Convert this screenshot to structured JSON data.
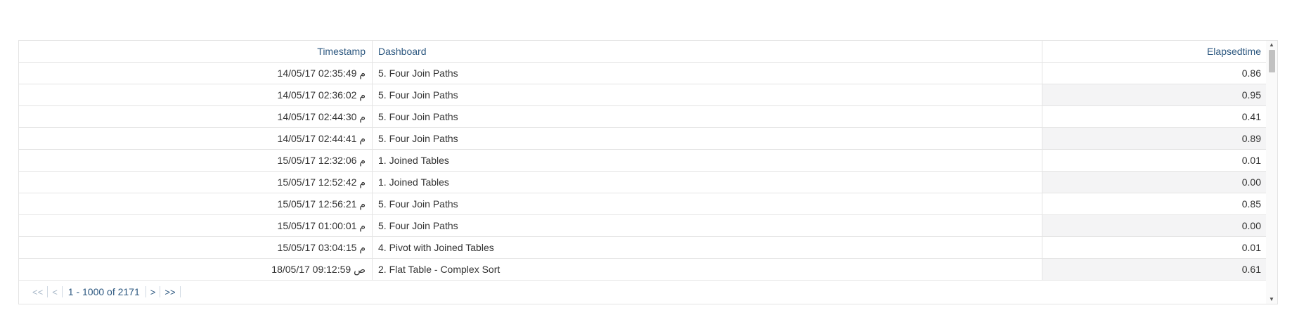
{
  "table": {
    "columns": {
      "timestamp": "Timestamp",
      "dashboard": "Dashboard",
      "elapsed": "Elapsedtime"
    },
    "rows": [
      {
        "timestamp": "14/05/17 02:35:49 م",
        "dashboard": "5. Four Join Paths",
        "elapsed": "0.86"
      },
      {
        "timestamp": "14/05/17 02:36:02 م",
        "dashboard": "5. Four Join Paths",
        "elapsed": "0.95"
      },
      {
        "timestamp": "14/05/17 02:44:30 م",
        "dashboard": "5. Four Join Paths",
        "elapsed": "0.41"
      },
      {
        "timestamp": "14/05/17 02:44:41 م",
        "dashboard": "5. Four Join Paths",
        "elapsed": "0.89"
      },
      {
        "timestamp": "15/05/17 12:32:06 م",
        "dashboard": "1. Joined Tables",
        "elapsed": "0.01"
      },
      {
        "timestamp": "15/05/17 12:52:42 م",
        "dashboard": "1. Joined Tables",
        "elapsed": "0.00"
      },
      {
        "timestamp": "15/05/17 12:56:21 م",
        "dashboard": "5. Four Join Paths",
        "elapsed": "0.85"
      },
      {
        "timestamp": "15/05/17 01:00:01 م",
        "dashboard": "5. Four Join Paths",
        "elapsed": "0.00"
      },
      {
        "timestamp": "15/05/17 03:04:15 م",
        "dashboard": "4. Pivot with Joined Tables",
        "elapsed": "0.01"
      },
      {
        "timestamp": "18/05/17 09:12:59 ص",
        "dashboard": "2. Flat Table - Complex Sort",
        "elapsed": "0.61"
      }
    ]
  },
  "pager": {
    "first_icon": "<<",
    "prev_icon": "<",
    "range": "1 - 1000 of 2171",
    "next_icon": ">",
    "last_icon": ">>"
  },
  "scrollbar": {
    "up_icon": "▲",
    "down_icon": "▼"
  }
}
